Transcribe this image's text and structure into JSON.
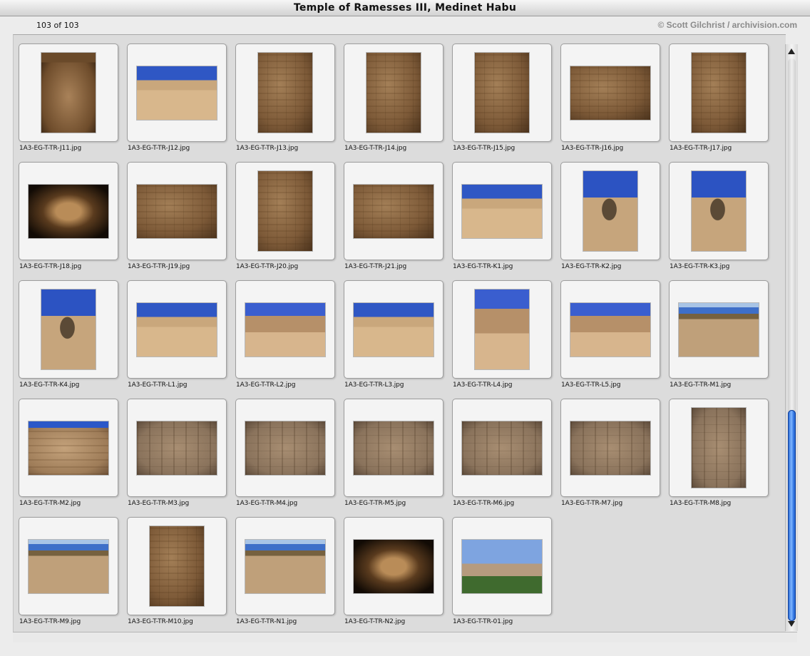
{
  "window": {
    "title": "Temple of Ramesses III, Medinet Habu"
  },
  "info": {
    "count": "103 of 103",
    "copyright": "© Scott Gilchrist / archivision.com"
  },
  "thumbnails": [
    {
      "file": "1A3-EG-T-TR-J11.jpg",
      "orientation": "portrait",
      "subject": "chamber"
    },
    {
      "file": "1A3-EG-T-TR-J12.jpg",
      "orientation": "landscape",
      "subject": "court"
    },
    {
      "file": "1A3-EG-T-TR-J13.jpg",
      "orientation": "portrait",
      "subject": "wall"
    },
    {
      "file": "1A3-EG-T-TR-J14.jpg",
      "orientation": "portrait",
      "subject": "wall"
    },
    {
      "file": "1A3-EG-T-TR-J15.jpg",
      "orientation": "portrait",
      "subject": "wall"
    },
    {
      "file": "1A3-EG-T-TR-J16.jpg",
      "orientation": "landscape",
      "subject": "wall"
    },
    {
      "file": "1A3-EG-T-TR-J17.jpg",
      "orientation": "portrait",
      "subject": "wall"
    },
    {
      "file": "1A3-EG-T-TR-J18.jpg",
      "orientation": "landscape",
      "subject": "dark"
    },
    {
      "file": "1A3-EG-T-TR-J19.jpg",
      "orientation": "landscape",
      "subject": "wall"
    },
    {
      "file": "1A3-EG-T-TR-J20.jpg",
      "orientation": "portrait",
      "subject": "wall"
    },
    {
      "file": "1A3-EG-T-TR-J21.jpg",
      "orientation": "landscape",
      "subject": "wall"
    },
    {
      "file": "1A3-EG-T-TR-K1.jpg",
      "orientation": "landscape",
      "subject": "court"
    },
    {
      "file": "1A3-EG-T-TR-K2.jpg",
      "orientation": "portrait",
      "subject": "statue"
    },
    {
      "file": "1A3-EG-T-TR-K3.jpg",
      "orientation": "portrait",
      "subject": "statue"
    },
    {
      "file": "1A3-EG-T-TR-K4.jpg",
      "orientation": "portrait",
      "subject": "statue"
    },
    {
      "file": "1A3-EG-T-TR-L1.jpg",
      "orientation": "landscape",
      "subject": "court"
    },
    {
      "file": "1A3-EG-T-TR-L2.jpg",
      "orientation": "landscape",
      "subject": "courtdeep"
    },
    {
      "file": "1A3-EG-T-TR-L3.jpg",
      "orientation": "landscape",
      "subject": "court"
    },
    {
      "file": "1A3-EG-T-TR-L4.jpg",
      "orientation": "portrait",
      "subject": "courtdeep"
    },
    {
      "file": "1A3-EG-T-TR-L5.jpg",
      "orientation": "landscape",
      "subject": "courtdeep"
    },
    {
      "file": "1A3-EG-T-TR-M1.jpg",
      "orientation": "landscape",
      "subject": "sky"
    },
    {
      "file": "1A3-EG-T-TR-M2.jpg",
      "orientation": "landscape",
      "subject": "pylon"
    },
    {
      "file": "1A3-EG-T-TR-M3.jpg",
      "orientation": "landscape",
      "subject": "relief"
    },
    {
      "file": "1A3-EG-T-TR-M4.jpg",
      "orientation": "landscape",
      "subject": "relief"
    },
    {
      "file": "1A3-EG-T-TR-M5.jpg",
      "orientation": "landscape",
      "subject": "relief"
    },
    {
      "file": "1A3-EG-T-TR-M6.jpg",
      "orientation": "landscape",
      "subject": "relief"
    },
    {
      "file": "1A3-EG-T-TR-M7.jpg",
      "orientation": "landscape",
      "subject": "relief"
    },
    {
      "file": "1A3-EG-T-TR-M8.jpg",
      "orientation": "portrait",
      "subject": "relief"
    },
    {
      "file": "1A3-EG-T-TR-M9.jpg",
      "orientation": "landscape",
      "subject": "sky"
    },
    {
      "file": "1A3-EG-T-TR-M10.jpg",
      "orientation": "portrait",
      "subject": "wall"
    },
    {
      "file": "1A3-EG-T-TR-N1.jpg",
      "orientation": "landscape",
      "subject": "sky"
    },
    {
      "file": "1A3-EG-T-TR-N2.jpg",
      "orientation": "landscape",
      "subject": "dark"
    },
    {
      "file": "1A3-EG-T-TR-01.jpg",
      "orientation": "landscape",
      "subject": "landscape"
    }
  ],
  "scrollbar": {
    "position": 0.92,
    "visible_fraction": 0.37
  }
}
